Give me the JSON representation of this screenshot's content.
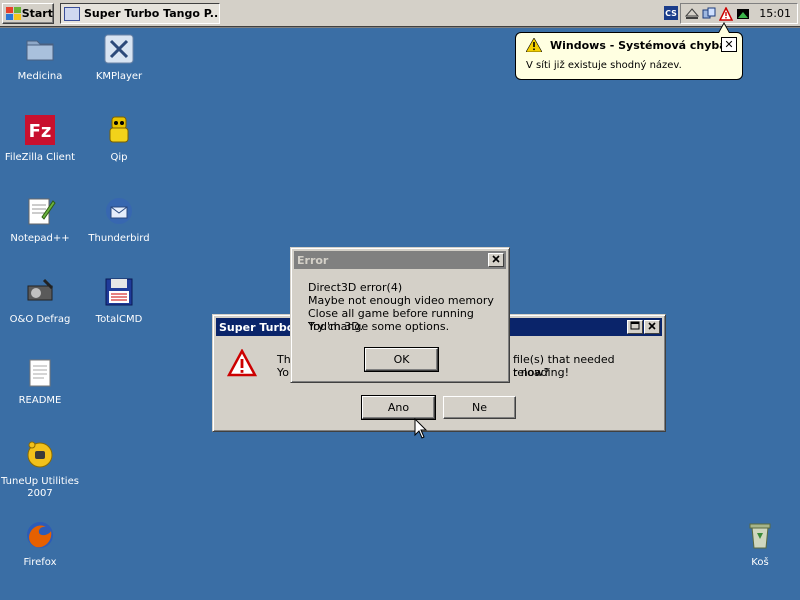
{
  "taskbar": {
    "start_label": "Start",
    "task_label": "Super Turbo Tango P...",
    "tray_cs": "CS",
    "clock": "15:01"
  },
  "balloon": {
    "title": "Windows - Systémová chyba",
    "text": "V síti již existuje shodný název.",
    "close": "✕"
  },
  "desktop_icons": [
    {
      "label": "Medicina",
      "icon": "folder-icon"
    },
    {
      "label": "KMPlayer",
      "icon": "kmplayer-icon"
    },
    {
      "label": "FileZilla Client",
      "icon": "filezilla-icon"
    },
    {
      "label": "Qip",
      "icon": "qip-icon"
    },
    {
      "label": "Notepad++",
      "icon": "notepad-icon"
    },
    {
      "label": "Thunderbird",
      "icon": "thunderbird-icon"
    },
    {
      "label": "O&O Defrag",
      "icon": "defrag-icon"
    },
    {
      "label": "TotalCMD",
      "icon": "totalcmd-icon"
    },
    {
      "label": "README",
      "icon": "text-file-icon"
    },
    {
      "label": "TuneUp Utilities 2007",
      "icon": "tuneup-icon"
    },
    {
      "label": "Firefox",
      "icon": "firefox-icon"
    },
    {
      "label": "Koš",
      "icon": "recycle-bin-icon"
    }
  ],
  "back_dialog": {
    "title": "Super Turbo",
    "line1_left": "The",
    "line1_right": "file(s) that needed reloading!",
    "line2_left": "You",
    "line2_right": "t now?",
    "yes": "Ano",
    "no": "Ne"
  },
  "error_dialog": {
    "title": "Error",
    "lines": [
      "Direct3D error(4)",
      "Maybe not enough video memory",
      "Close all game before running Yod'm 3D.",
      "Try change some options."
    ],
    "ok": "OK"
  },
  "colors": {
    "desktop": "#3a6ea5",
    "active_title": "#0a246a",
    "inactive_title": "#808080"
  }
}
